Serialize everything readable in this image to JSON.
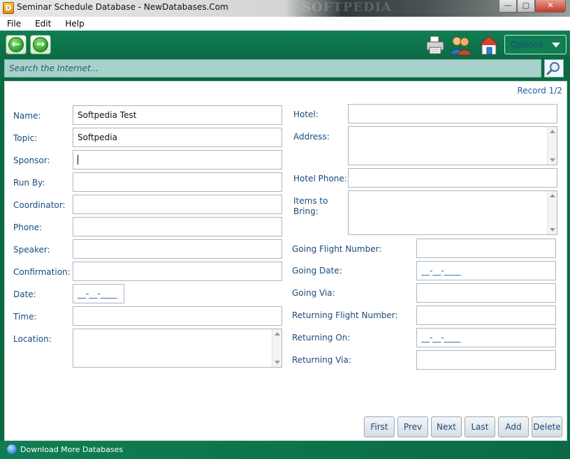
{
  "window": {
    "title": "Seminar Schedule Database - NewDatabases.Com",
    "watermark": "SOFTPEDIA"
  },
  "menubar": {
    "items": [
      "File",
      "Edit",
      "Help"
    ]
  },
  "toolbar": {
    "options_label": "Options",
    "icons": [
      "back-arrow",
      "forward-arrow",
      "printer",
      "users",
      "home"
    ]
  },
  "search": {
    "placeholder": "Search the Internet..."
  },
  "record": {
    "label": "Record 1/2"
  },
  "left_fields": [
    {
      "label": "Name:",
      "value": "Softpedia Test"
    },
    {
      "label": "Topic:",
      "value": "Softpedia"
    },
    {
      "label": "Sponsor:",
      "value": ""
    },
    {
      "label": "Run By:",
      "value": ""
    },
    {
      "label": "Coordinator:",
      "value": ""
    },
    {
      "label": "Phone:",
      "value": ""
    },
    {
      "label": "Speaker:",
      "value": ""
    },
    {
      "label": "Confirmation:",
      "value": ""
    },
    {
      "label": "Date:",
      "value": "__-__-____"
    },
    {
      "label": "Time:",
      "value": ""
    },
    {
      "label": "Location:",
      "value": ""
    }
  ],
  "right_fields": [
    {
      "label": "Hotel:",
      "value": ""
    },
    {
      "label": "Address:",
      "value": ""
    },
    {
      "label": "Hotel Phone:",
      "value": ""
    },
    {
      "label": "Items to Bring:",
      "value": ""
    },
    {
      "label": "Going Flight Number:",
      "value": ""
    },
    {
      "label": "Going Date:",
      "value": "__-__-____"
    },
    {
      "label": "Going Via:",
      "value": ""
    },
    {
      "label": "Returning Flight Number:",
      "value": ""
    },
    {
      "label": "Returning On:",
      "value": "__-__-____"
    },
    {
      "label": "Returning Via:",
      "value": ""
    }
  ],
  "nav_buttons": [
    "First",
    "Prev",
    "Next",
    "Last",
    "Add",
    "Delete"
  ],
  "status": {
    "text": "Download More Databases"
  },
  "colors": {
    "toolbar": "#0b6a44",
    "search_bg": "#a9d1cb",
    "label": "#174b7e"
  }
}
